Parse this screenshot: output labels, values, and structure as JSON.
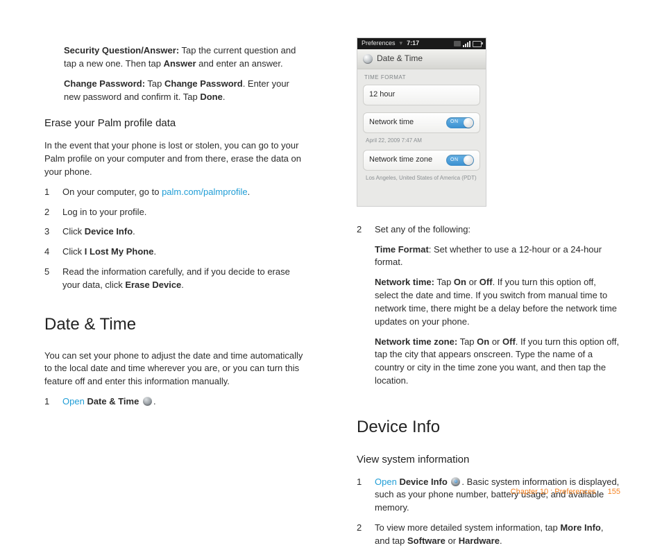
{
  "left": {
    "introA": {
      "boldLead": "Security Question/Answer:",
      "tail1": " Tap the current question and tap a new one. Then tap ",
      "bold2": "Answer",
      "tail2": " and enter an answer."
    },
    "introB": {
      "boldLead": "Change Password:",
      "tail1": " Tap ",
      "bold2": "Change Password",
      "tail2": ". Enter your new password and confirm it. Tap ",
      "bold3": "Done",
      "tail3": "."
    },
    "h_erase": "Erase your Palm profile data",
    "erase_p": "In the event that your phone is lost or stolen, you can go to your Palm profile on your computer and from there, erase the data on your phone.",
    "erase_steps": {
      "s1_a": "On your computer, go to ",
      "s1_link": "palm.com/palmprofile",
      "s1_b": ".",
      "s2": "Log in to your profile.",
      "s3_a": "Click ",
      "s3_b": "Device Info",
      "s3_c": ".",
      "s4_a": "Click ",
      "s4_b": "I Lost My Phone",
      "s4_c": ".",
      "s5_a": "Read the information carefully, and if you decide to erase your data, click ",
      "s5_b": "Erase Device",
      "s5_c": "."
    },
    "h_dt": "Date & Time",
    "dt_p": "You can set your phone to adjust the date and time automatically to the local date and time wherever you are, or you can turn this feature off and enter this information manually.",
    "dt_step1_open": "Open",
    "dt_step1_b": "Date & Time",
    "dt_step1_tail": "."
  },
  "phone": {
    "status_left": "Preferences",
    "status_time": "7:17",
    "title": "Date & Time",
    "sect": "TIME FORMAT",
    "row1": "12 hour",
    "row2": "Network time",
    "row2_sub": "April 22, 2009 7:47 AM",
    "row3": "Network time zone",
    "row3_sub": "Los Angeles, United States of America (PDT)",
    "on": "ON"
  },
  "right": {
    "step2_lead": "Set any of the following:",
    "tf_b": "Time Format",
    "tf_t": ": Set whether to use a 12-hour or a 24-hour format.",
    "nt_b": "Network time:",
    "nt_t1": " Tap ",
    "nt_on": "On",
    "nt_or": " or ",
    "nt_off": "Off",
    "nt_t2": ". If you turn this option off, select the date and time. If you switch from manual time to network time, there might be a delay before the network time updates on your phone.",
    "ntz_b": "Network time zone:",
    "ntz_t1": " Tap ",
    "ntz_t2": ". If you turn this option off, tap the city that appears onscreen. Type the name of a country or city in the time zone you want, and then tap the location.",
    "h_di": "Device Info",
    "h_view": "View system information",
    "di1_open": "Open",
    "di1_b": "Device Info",
    "di1_tail": ". Basic system information is displayed, such as your phone number, battery usage, and available memory.",
    "di2_a": "To view more detailed system information, tap ",
    "di2_b": "More Info",
    "di2_c": ", and tap ",
    "di2_d": "Software",
    "di2_e": " or ",
    "di2_f": "Hardware",
    "di2_g": "."
  },
  "footer": {
    "breadcrumb": "Chapter 10 : Preferences",
    "page": "155"
  },
  "nums": {
    "n1": "1",
    "n2": "2",
    "n3": "3",
    "n4": "4",
    "n5": "5"
  }
}
